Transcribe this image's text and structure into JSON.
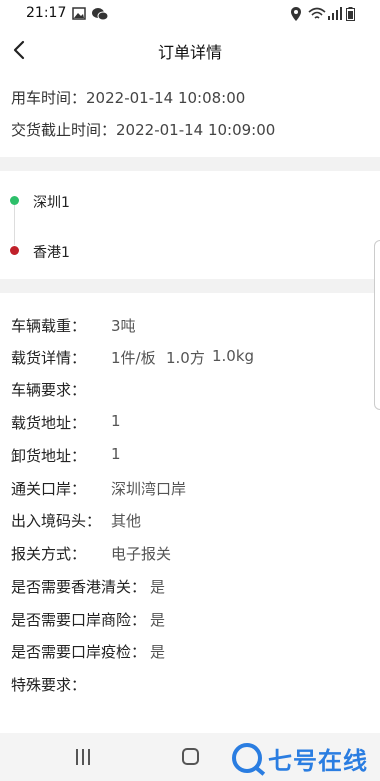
{
  "status_bar": {
    "time": "21:17",
    "icons": [
      "image-icon",
      "wechat-icon",
      "location-icon",
      "wifi-icon",
      "signal-icon",
      "battery-icon"
    ]
  },
  "header": {
    "title": "订单详情",
    "back_icon": "chevron-left-icon"
  },
  "times": {
    "use_label": "用车时间：",
    "use_value": "2022-01-14 10:08:00",
    "deadline_label": "交货截止时间：",
    "deadline_value": "2022-01-14 10:09:00"
  },
  "route": {
    "origin": "深圳1",
    "destination": "香港1",
    "origin_color": "#2dbf6a",
    "destination_color": "#c0202a"
  },
  "details": {
    "load_weight_label": "车辆载重：",
    "load_weight_value": "3吨",
    "cargo_label": "载货详情：",
    "cargo_pieces": "1件/板",
    "cargo_volume": "1.0方",
    "cargo_weight": "1.0kg",
    "vehicle_req_label": "车辆要求：",
    "load_addr_label": "载货地址：",
    "load_addr_value": "1",
    "unload_addr_label": "卸货地址：",
    "unload_addr_value": "1",
    "port_label": "通关口岸：",
    "port_value": "深圳湾口岸",
    "border_label": "出入境码头：",
    "border_value": "其他",
    "declare_label": "报关方式：",
    "declare_value": "电子报关",
    "hk_clear_label": "是否需要香港清关：",
    "hk_clear_value": "是",
    "insurance_label": "是否需要口岸商险：",
    "insurance_value": "是",
    "quarantine_label": "是否需要口岸疫检：",
    "quarantine_value": "是",
    "special_label": "特殊要求："
  },
  "nav": {
    "brand": "七号在线"
  },
  "colors": {
    "brand": "#2a7de1",
    "gap": "#f2f2f2"
  }
}
